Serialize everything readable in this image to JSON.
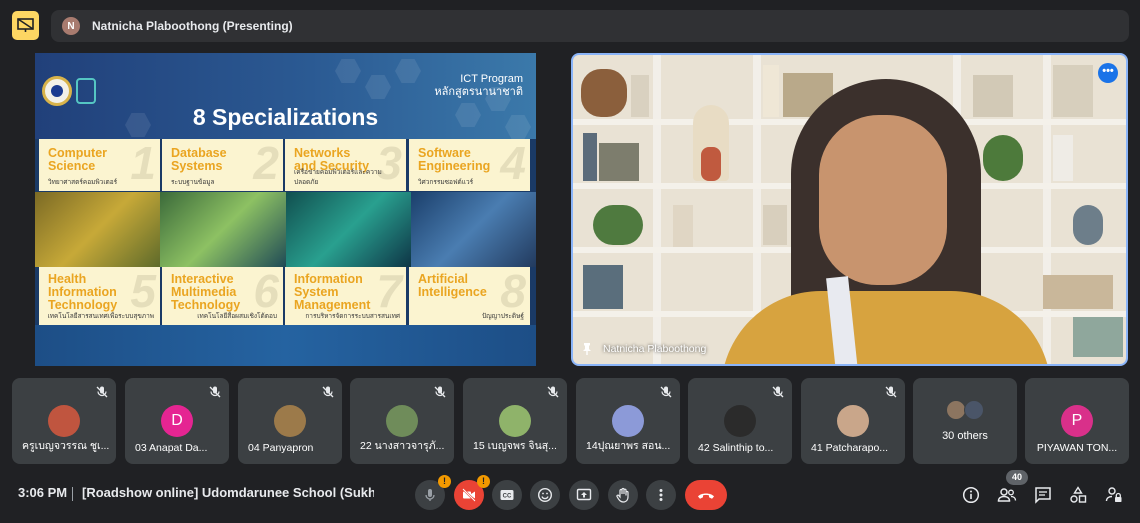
{
  "presenter_bar": {
    "avatar_initial": "N",
    "label": "Natnicha Plaboothong (Presenting)"
  },
  "slide": {
    "program_en": "ICT Program",
    "program_th": "หลักสูตรนานาชาติ",
    "title": "8 Specializations",
    "specializations": [
      {
        "num": "1",
        "en": "Computer\nScience",
        "th": "วิทยาศาสตร์คอมพิวเตอร์"
      },
      {
        "num": "2",
        "en": "Database\nSystems",
        "th": "ระบบฐานข้อมูล"
      },
      {
        "num": "3",
        "en": "Networks\nand Security",
        "th": "เครือข่ายคอมพิวเตอร์และความปลอดภัย"
      },
      {
        "num": "4",
        "en": "Software\nEngineering",
        "th": "วิศวกรรมซอฟต์แวร์"
      },
      {
        "num": "5",
        "en": "Health\nInformation\nTechnology",
        "th": "เทคโนโลยีสารสนเทศเพื่อระบบสุขภาพ"
      },
      {
        "num": "6",
        "en": "Interactive\nMultimedia\nTechnology",
        "th": "เทคโนโลยีสื่อผสมเชิงโต้ตอบ"
      },
      {
        "num": "7",
        "en": "Information\nSystem\nManagement",
        "th": "การบริหารจัดการระบบสารสนเทศ"
      },
      {
        "num": "8",
        "en": "Artificial\nIntelligence",
        "th": "ปัญญาประดิษฐ์"
      }
    ]
  },
  "speaker": {
    "name": "Natnicha Plaboothong",
    "more_label": "•••"
  },
  "participants": [
    {
      "name": "ครูเบญจวรรณ ชูเ...",
      "initial": "",
      "color": "#c0553f"
    },
    {
      "name": "03 Anapat Da...",
      "initial": "D",
      "color": "#e52592"
    },
    {
      "name": "04 Panyapron",
      "initial": "",
      "color": "#9c7a4a"
    },
    {
      "name": "22 นางสาวจารุภั...",
      "initial": "",
      "color": "#6f8c5a"
    },
    {
      "name": "15 เบญจพร จินสุ...",
      "initial": "",
      "color": "#8fb36a"
    },
    {
      "name": "14ปุณยาพร สอน...",
      "initial": "",
      "color": "#8c9ad8"
    },
    {
      "name": "42 Salinthip to...",
      "initial": "",
      "color": "#2b2b2b"
    },
    {
      "name": "41 Patcharapo...",
      "initial": "",
      "color": "#c9a68a"
    }
  ],
  "others": {
    "label": "30 others"
  },
  "last_participant": {
    "name": "PIYAWAN TON...",
    "initial": "P",
    "color": "#d9308a"
  },
  "bottom_bar": {
    "time": "3:06 PM",
    "meeting_title": "[Roadshow online] Udomdarunee School (Sukhoth...",
    "warning_mark": "!",
    "people_count": "40"
  },
  "colors": {
    "background": "#202124",
    "tile": "#3c4043",
    "accent": "#8ab4f8",
    "hangup": "#ea4335",
    "presenting": "#fdd663"
  }
}
